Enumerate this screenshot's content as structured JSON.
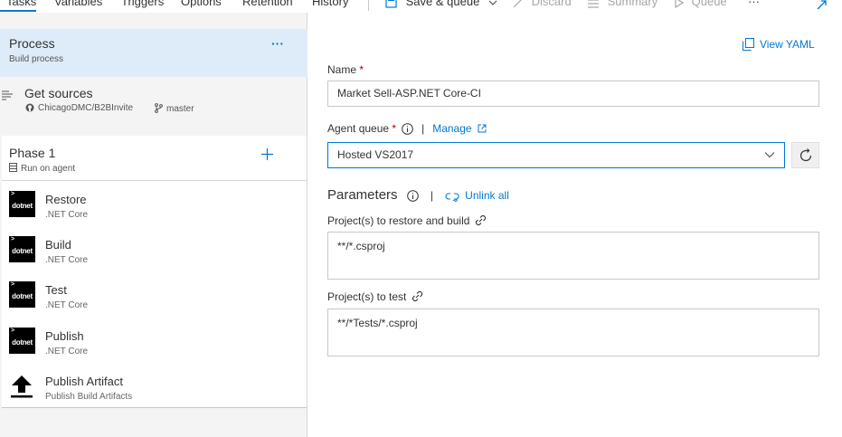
{
  "toolbar": {
    "tabs": [
      "Tasks",
      "Variables",
      "Triggers",
      "Options",
      "Retention",
      "History"
    ],
    "save_queue": "Save & queue",
    "discard": "Discard",
    "summary": "Summary",
    "queue": "Queue",
    "more": "···"
  },
  "process": {
    "title": "Process",
    "subtitle": "Build process",
    "more": "···"
  },
  "get_sources": {
    "title": "Get sources",
    "repo": "ChicagoDMC/B2BInvite",
    "branch": "master"
  },
  "phase": {
    "title": "Phase 1",
    "subtitle": "Run on agent"
  },
  "tasks": [
    {
      "title": "Restore",
      "subtitle": ".NET Core",
      "logo": "dotnet"
    },
    {
      "title": "Build",
      "subtitle": ".NET Core",
      "logo": "dotnet"
    },
    {
      "title": "Test",
      "subtitle": ".NET Core",
      "logo": "dotnet"
    },
    {
      "title": "Publish",
      "subtitle": ".NET Core",
      "logo": "dotnet"
    },
    {
      "title": "Publish Artifact",
      "subtitle": "Publish Build Artifacts"
    }
  ],
  "details": {
    "view_yaml": "View YAML",
    "name_label": "Name",
    "name_value": "Market Sell-ASP.NET Core-CI",
    "agent_queue_label": "Agent queue",
    "manage": "Manage",
    "agent_queue_value": "Hosted VS2017",
    "parameters": "Parameters",
    "unlink_all": "Unlink all",
    "restore_build_label": "Project(s) to restore and build",
    "restore_build_value": "**/*.csproj",
    "test_label": "Project(s) to test",
    "test_value": "**/*Tests/*.csproj",
    "required_mark": "*"
  },
  "colors": {
    "accent": "#0078d4",
    "selected_bg": "#deecf9",
    "pane_bg": "#f4f4f4"
  }
}
